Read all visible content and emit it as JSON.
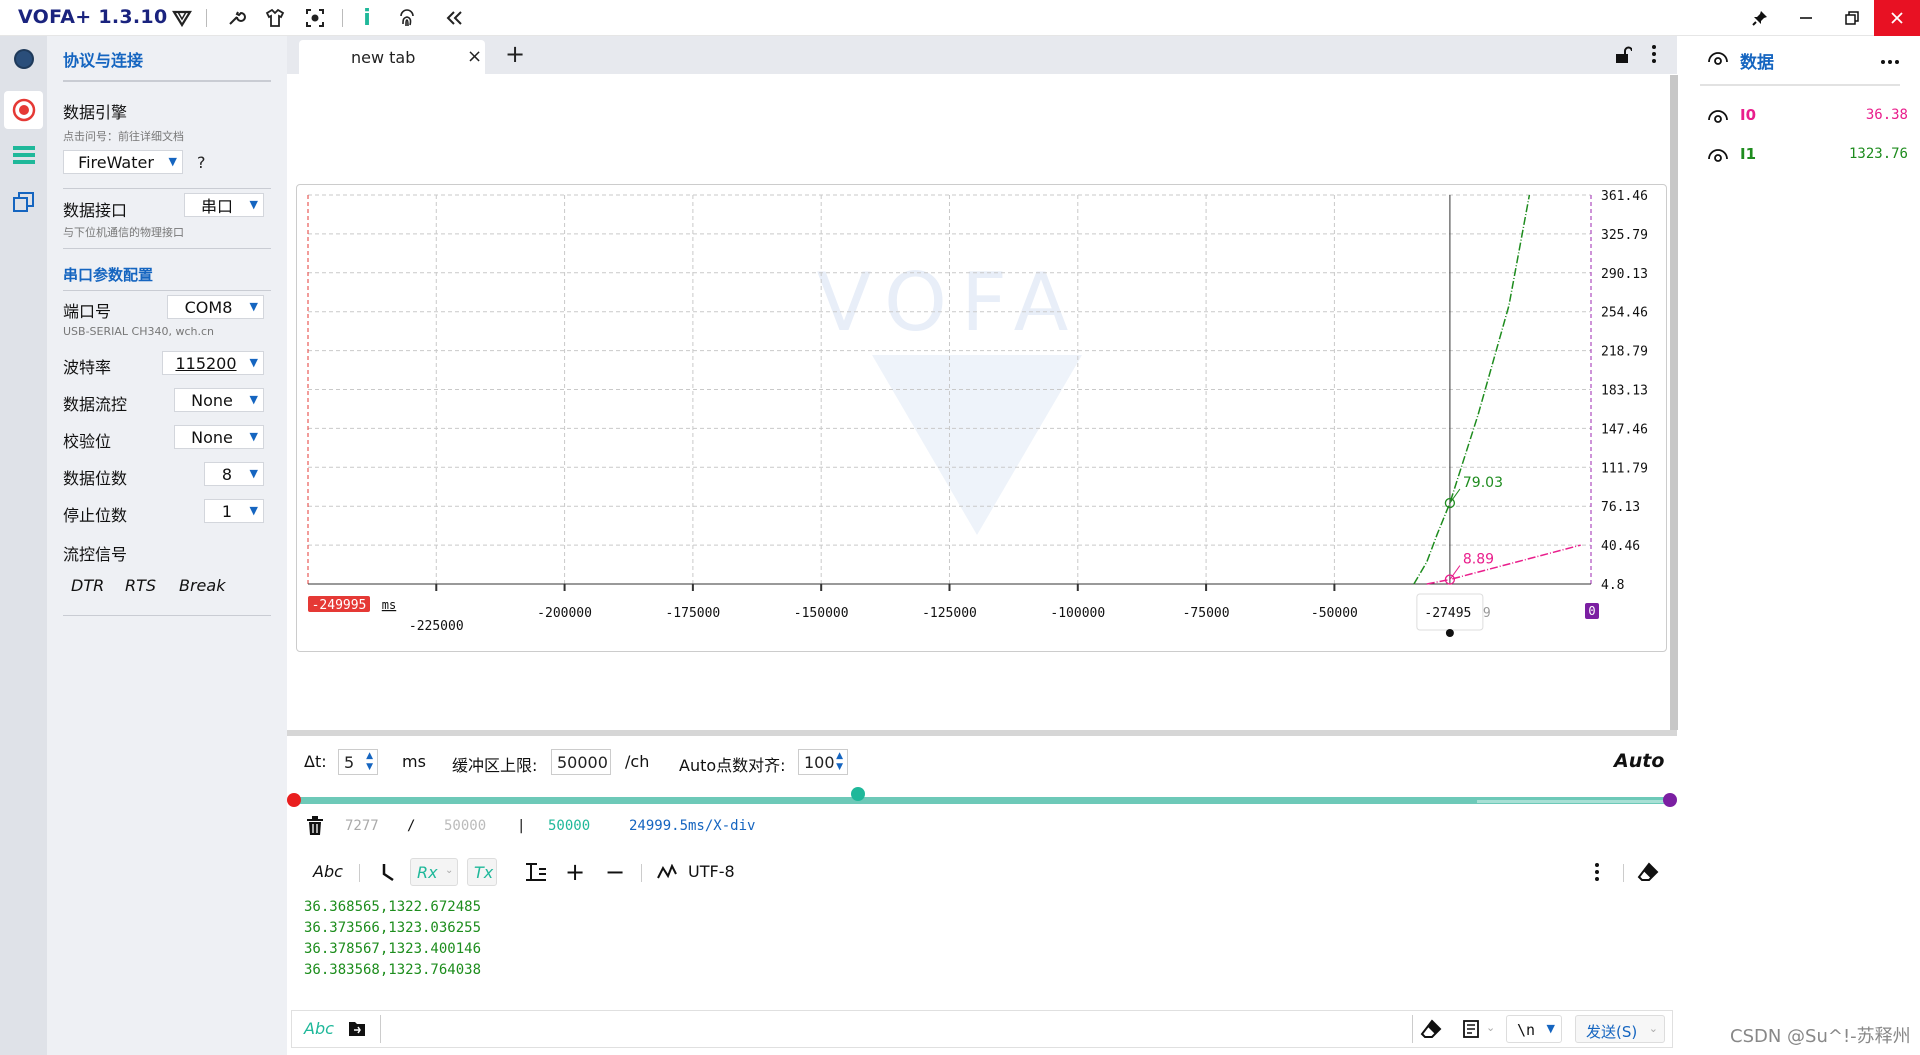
{
  "app": {
    "title": "VOFA+ 1.3.10"
  },
  "window_controls": [
    "pin",
    "minimize",
    "restore",
    "close"
  ],
  "toolbar": [
    "vofa-logo-icon",
    "wrench-icon",
    "shirt-icon",
    "capture-icon",
    "info-icon",
    "fingerprint-icon",
    "collapse-icon"
  ],
  "sidebar": {
    "section_title": "协议与连接",
    "engine_label": "数据引擎",
    "engine_hint": "点击问号：前往详细文档",
    "engine_value": "FireWater",
    "help": "?",
    "iface_label": "数据接口",
    "iface_value": "串口",
    "iface_hint": "与下位机通信的物理接口",
    "serial_title": "串口参数配置",
    "port_label": "端口号",
    "port_value": "COM8",
    "port_hint": "USB-SERIAL CH340, wch.cn",
    "baud_label": "波特率",
    "baud_value": "115200",
    "flow_label": "数据流控",
    "flow_value": "None",
    "parity_label": "校验位",
    "parity_value": "None",
    "databits_label": "数据位数",
    "databits_value": "8",
    "stopbits_label": "停止位数",
    "stopbits_value": "1",
    "signal_label": "流控信号",
    "dtr": "DTR",
    "rts": "RTS",
    "brk": "Break"
  },
  "tab": {
    "label": "new tab",
    "close": "×",
    "add": "+"
  },
  "chart_data": {
    "type": "line",
    "watermark": "VOFA",
    "x_unit": "ms",
    "x_ticks": [
      -225000,
      -200000,
      -175000,
      -150000,
      -125000,
      -100000,
      -75000,
      -50000
    ],
    "x_tick_labels": [
      "-225000",
      "-200000",
      "-175000",
      "-150000",
      "-125000",
      "-100000",
      "-75000",
      "-50000"
    ],
    "y_ticks": [
      361.46,
      325.79,
      290.13,
      254.46,
      218.79,
      183.13,
      147.46,
      111.79,
      76.13,
      40.46,
      4.8
    ],
    "y_tick_labels": [
      "361.46",
      "325.79",
      "290.13",
      "254.46",
      "218.79",
      "183.13",
      "147.46",
      "111.79",
      "76.13",
      "40.46",
      "4.8"
    ],
    "ylim": [
      4.8,
      361.46
    ],
    "xlim": [
      -249995,
      0
    ],
    "x_start_label": "-249995",
    "x_end_label": "0",
    "cursor": {
      "x": -27495,
      "label": "-27495",
      "partial_label": "9"
    },
    "grid": true,
    "series": [
      {
        "name": "I0",
        "color": "#e91e8c",
        "points": [
          [
            -32000,
            4.8
          ],
          [
            -27495,
            8.89
          ],
          [
            -2000,
            40.46
          ]
        ],
        "marker": {
          "x": -27495,
          "y": 8.89,
          "label": "8.89"
        }
      },
      {
        "name": "I1",
        "color": "#1e8c1e",
        "points": [
          [
            -34500,
            4.8
          ],
          [
            -32000,
            25
          ],
          [
            -30000,
            50
          ],
          [
            -27495,
            79.03
          ],
          [
            -22000,
            160
          ],
          [
            -16000,
            260
          ],
          [
            -12000,
            361.46
          ]
        ],
        "marker": {
          "x": -27495,
          "y": 79.03,
          "label": "79.03"
        }
      }
    ]
  },
  "controls": {
    "dt_label": "Δt:",
    "dt_value": "5",
    "dt_unit": "ms",
    "buf_label": "缓冲区上限:",
    "buf_value": "50000",
    "buf_unit": "/ch",
    "auto_label": "Auto点数对齐:",
    "auto_value": "100",
    "mode": "Auto"
  },
  "timeline": {
    "position_fraction": 0.41
  },
  "stats": {
    "count": "7277",
    "sep1": "/",
    "limit": "50000",
    "sep2": "|",
    "buffer": "50000",
    "xdiv": "24999.5ms/X-div"
  },
  "rx_toolbar": {
    "abc": "Abc",
    "rx": "Rx",
    "tx": "Tx",
    "encoding": "UTF-8"
  },
  "rx_lines": [
    "36.368565,1322.672485",
    "36.373566,1323.036255",
    "36.378567,1323.400146",
    "36.383568,1323.764038"
  ],
  "tx_bar": {
    "abc": "Abc",
    "newline": "\\n",
    "send": "发送(S)"
  },
  "right_panel": {
    "title": "数据",
    "channels": [
      {
        "name": "I0",
        "value": "36.38",
        "color": "#e91e8c"
      },
      {
        "name": "I1",
        "value": "1323.76",
        "color": "#1e8c1e"
      }
    ]
  },
  "watermark": "CSDN @Su^!-苏释州"
}
